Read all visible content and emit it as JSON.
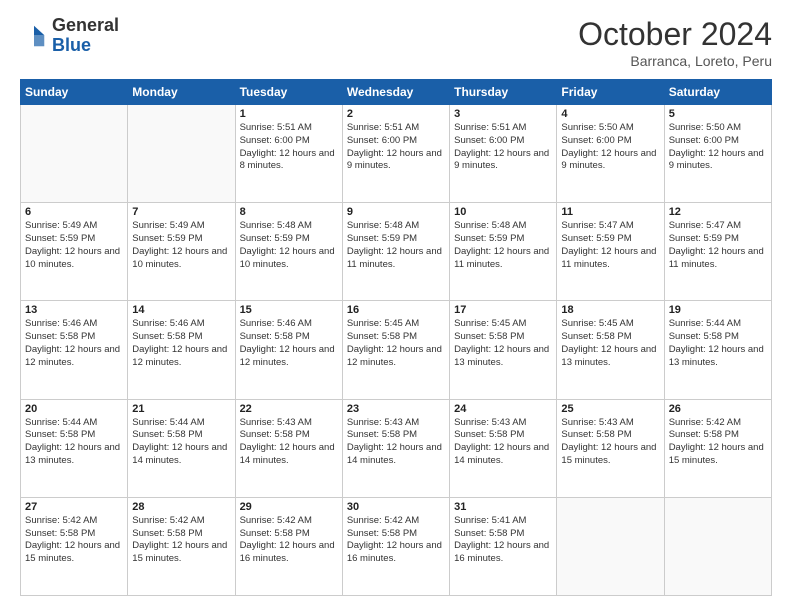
{
  "logo": {
    "general": "General",
    "blue": "Blue"
  },
  "header": {
    "month": "October 2024",
    "location": "Barranca, Loreto, Peru"
  },
  "weekdays": [
    "Sunday",
    "Monday",
    "Tuesday",
    "Wednesday",
    "Thursday",
    "Friday",
    "Saturday"
  ],
  "weeks": [
    [
      {
        "day": "",
        "info": ""
      },
      {
        "day": "",
        "info": ""
      },
      {
        "day": "1",
        "info": "Sunrise: 5:51 AM\nSunset: 6:00 PM\nDaylight: 12 hours and 8 minutes."
      },
      {
        "day": "2",
        "info": "Sunrise: 5:51 AM\nSunset: 6:00 PM\nDaylight: 12 hours and 9 minutes."
      },
      {
        "day": "3",
        "info": "Sunrise: 5:51 AM\nSunset: 6:00 PM\nDaylight: 12 hours and 9 minutes."
      },
      {
        "day": "4",
        "info": "Sunrise: 5:50 AM\nSunset: 6:00 PM\nDaylight: 12 hours and 9 minutes."
      },
      {
        "day": "5",
        "info": "Sunrise: 5:50 AM\nSunset: 6:00 PM\nDaylight: 12 hours and 9 minutes."
      }
    ],
    [
      {
        "day": "6",
        "info": "Sunrise: 5:49 AM\nSunset: 5:59 PM\nDaylight: 12 hours and 10 minutes."
      },
      {
        "day": "7",
        "info": "Sunrise: 5:49 AM\nSunset: 5:59 PM\nDaylight: 12 hours and 10 minutes."
      },
      {
        "day": "8",
        "info": "Sunrise: 5:48 AM\nSunset: 5:59 PM\nDaylight: 12 hours and 10 minutes."
      },
      {
        "day": "9",
        "info": "Sunrise: 5:48 AM\nSunset: 5:59 PM\nDaylight: 12 hours and 11 minutes."
      },
      {
        "day": "10",
        "info": "Sunrise: 5:48 AM\nSunset: 5:59 PM\nDaylight: 12 hours and 11 minutes."
      },
      {
        "day": "11",
        "info": "Sunrise: 5:47 AM\nSunset: 5:59 PM\nDaylight: 12 hours and 11 minutes."
      },
      {
        "day": "12",
        "info": "Sunrise: 5:47 AM\nSunset: 5:59 PM\nDaylight: 12 hours and 11 minutes."
      }
    ],
    [
      {
        "day": "13",
        "info": "Sunrise: 5:46 AM\nSunset: 5:58 PM\nDaylight: 12 hours and 12 minutes."
      },
      {
        "day": "14",
        "info": "Sunrise: 5:46 AM\nSunset: 5:58 PM\nDaylight: 12 hours and 12 minutes."
      },
      {
        "day": "15",
        "info": "Sunrise: 5:46 AM\nSunset: 5:58 PM\nDaylight: 12 hours and 12 minutes."
      },
      {
        "day": "16",
        "info": "Sunrise: 5:45 AM\nSunset: 5:58 PM\nDaylight: 12 hours and 12 minutes."
      },
      {
        "day": "17",
        "info": "Sunrise: 5:45 AM\nSunset: 5:58 PM\nDaylight: 12 hours and 13 minutes."
      },
      {
        "day": "18",
        "info": "Sunrise: 5:45 AM\nSunset: 5:58 PM\nDaylight: 12 hours and 13 minutes."
      },
      {
        "day": "19",
        "info": "Sunrise: 5:44 AM\nSunset: 5:58 PM\nDaylight: 12 hours and 13 minutes."
      }
    ],
    [
      {
        "day": "20",
        "info": "Sunrise: 5:44 AM\nSunset: 5:58 PM\nDaylight: 12 hours and 13 minutes."
      },
      {
        "day": "21",
        "info": "Sunrise: 5:44 AM\nSunset: 5:58 PM\nDaylight: 12 hours and 14 minutes."
      },
      {
        "day": "22",
        "info": "Sunrise: 5:43 AM\nSunset: 5:58 PM\nDaylight: 12 hours and 14 minutes."
      },
      {
        "day": "23",
        "info": "Sunrise: 5:43 AM\nSunset: 5:58 PM\nDaylight: 12 hours and 14 minutes."
      },
      {
        "day": "24",
        "info": "Sunrise: 5:43 AM\nSunset: 5:58 PM\nDaylight: 12 hours and 14 minutes."
      },
      {
        "day": "25",
        "info": "Sunrise: 5:43 AM\nSunset: 5:58 PM\nDaylight: 12 hours and 15 minutes."
      },
      {
        "day": "26",
        "info": "Sunrise: 5:42 AM\nSunset: 5:58 PM\nDaylight: 12 hours and 15 minutes."
      }
    ],
    [
      {
        "day": "27",
        "info": "Sunrise: 5:42 AM\nSunset: 5:58 PM\nDaylight: 12 hours and 15 minutes."
      },
      {
        "day": "28",
        "info": "Sunrise: 5:42 AM\nSunset: 5:58 PM\nDaylight: 12 hours and 15 minutes."
      },
      {
        "day": "29",
        "info": "Sunrise: 5:42 AM\nSunset: 5:58 PM\nDaylight: 12 hours and 16 minutes."
      },
      {
        "day": "30",
        "info": "Sunrise: 5:42 AM\nSunset: 5:58 PM\nDaylight: 12 hours and 16 minutes."
      },
      {
        "day": "31",
        "info": "Sunrise: 5:41 AM\nSunset: 5:58 PM\nDaylight: 12 hours and 16 minutes."
      },
      {
        "day": "",
        "info": ""
      },
      {
        "day": "",
        "info": ""
      }
    ]
  ]
}
